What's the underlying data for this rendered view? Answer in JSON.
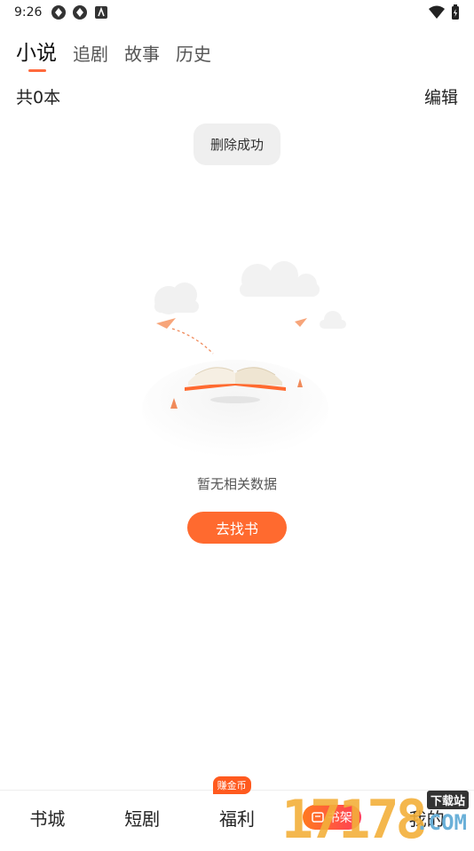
{
  "status_bar": {
    "time": "9:26"
  },
  "tabs": [
    {
      "label": "小说",
      "active": true
    },
    {
      "label": "追剧",
      "active": false
    },
    {
      "label": "故事",
      "active": false
    },
    {
      "label": "历史",
      "active": false
    }
  ],
  "count_label": "共0本",
  "edit_label": "编辑",
  "toast": "删除成功",
  "empty_message": "暂无相关数据",
  "find_button": "去找书",
  "bottom_nav": [
    {
      "label": "书城",
      "badge": ""
    },
    {
      "label": "短剧",
      "badge": ""
    },
    {
      "label": "福利",
      "badge": "赚金币"
    },
    {
      "label": "书架",
      "active": true
    },
    {
      "label": "我的"
    }
  ],
  "watermark": {
    "number": "17178",
    "tag": "下载站",
    "suffix": ".COM"
  },
  "colors": {
    "accent": "#ff6a2f",
    "indicator": "#ff6a3d"
  }
}
